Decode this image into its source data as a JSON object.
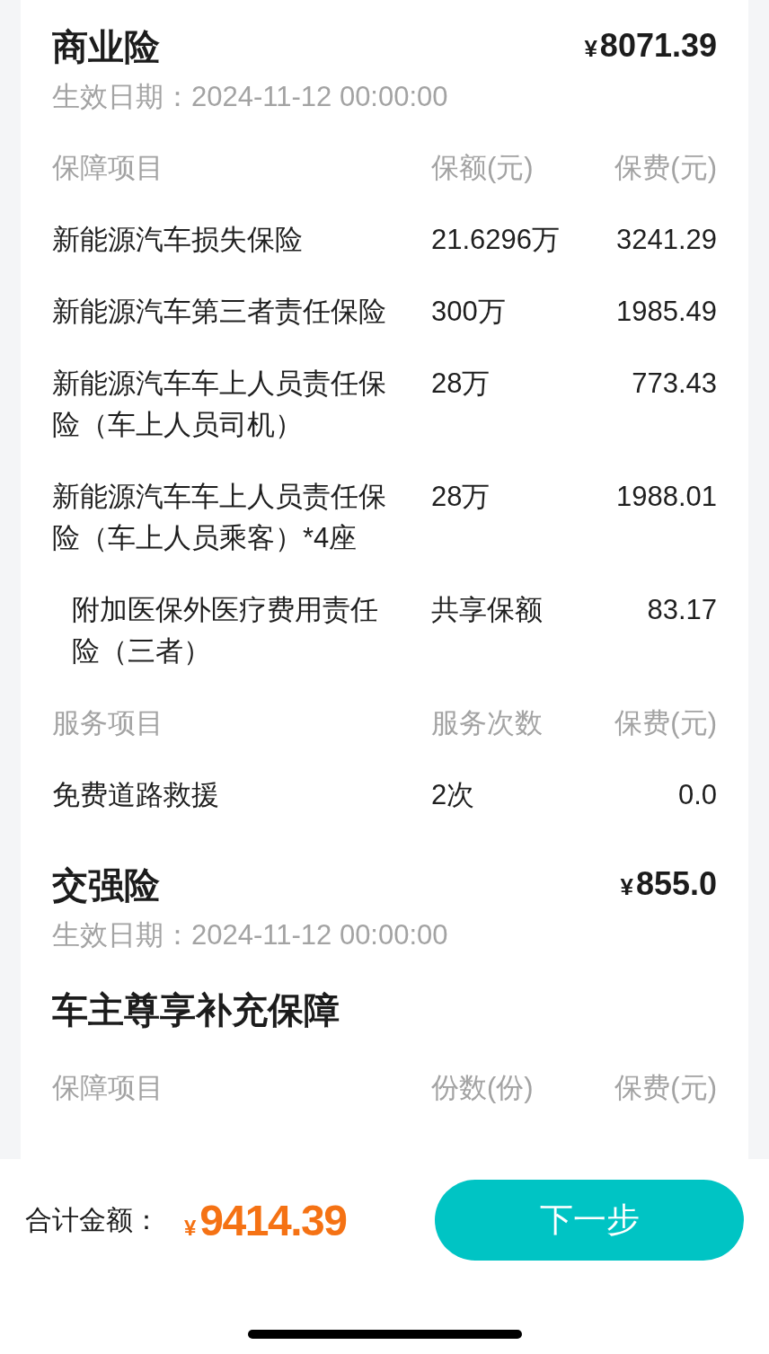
{
  "sections": [
    {
      "title": "商业险",
      "currency": "¥",
      "price": "8071.39",
      "effective_date": "生效日期：2024-11-12 00:00:00",
      "tables": [
        {
          "columns": [
            "保障项目",
            "保额(元)",
            "保费(元)"
          ],
          "rows": [
            {
              "kind": "main",
              "name": "新能源汽车损失保险",
              "amount": "21.6296万",
              "premium": "3241.29"
            },
            {
              "kind": "main",
              "name": "新能源汽车第三者责任保险",
              "amount": "300万",
              "premium": "1985.49"
            },
            {
              "kind": "main",
              "name": "新能源汽车车上人员责任保险（车上人员司机）",
              "amount": "28万",
              "premium": "773.43"
            },
            {
              "kind": "main",
              "name": "新能源汽车车上人员责任保险（车上人员乘客）*4座",
              "amount": "28万",
              "premium": "1988.01"
            },
            {
              "kind": "rider",
              "name": "附加医保外医疗费用责任险（三者）",
              "amount": "共享保额",
              "premium": "83.17"
            }
          ]
        },
        {
          "columns": [
            "服务项目",
            "服务次数",
            "保费(元)"
          ],
          "rows": [
            {
              "kind": "main",
              "name": "免费道路救援",
              "amount": "2次",
              "premium": "0.0"
            }
          ]
        }
      ]
    },
    {
      "title": "交强险",
      "currency": "¥",
      "price": "855.0",
      "effective_date": "生效日期：2024-11-12 00:00:00"
    },
    {
      "title": "车主尊享补充保障",
      "tables": [
        {
          "columns": [
            "保障项目",
            "份数(份)",
            "保费(元)"
          ]
        }
      ]
    }
  ],
  "footer": {
    "total_label": "合计金额：",
    "currency": "¥",
    "total": "9414.39",
    "next_button": "下一步"
  }
}
